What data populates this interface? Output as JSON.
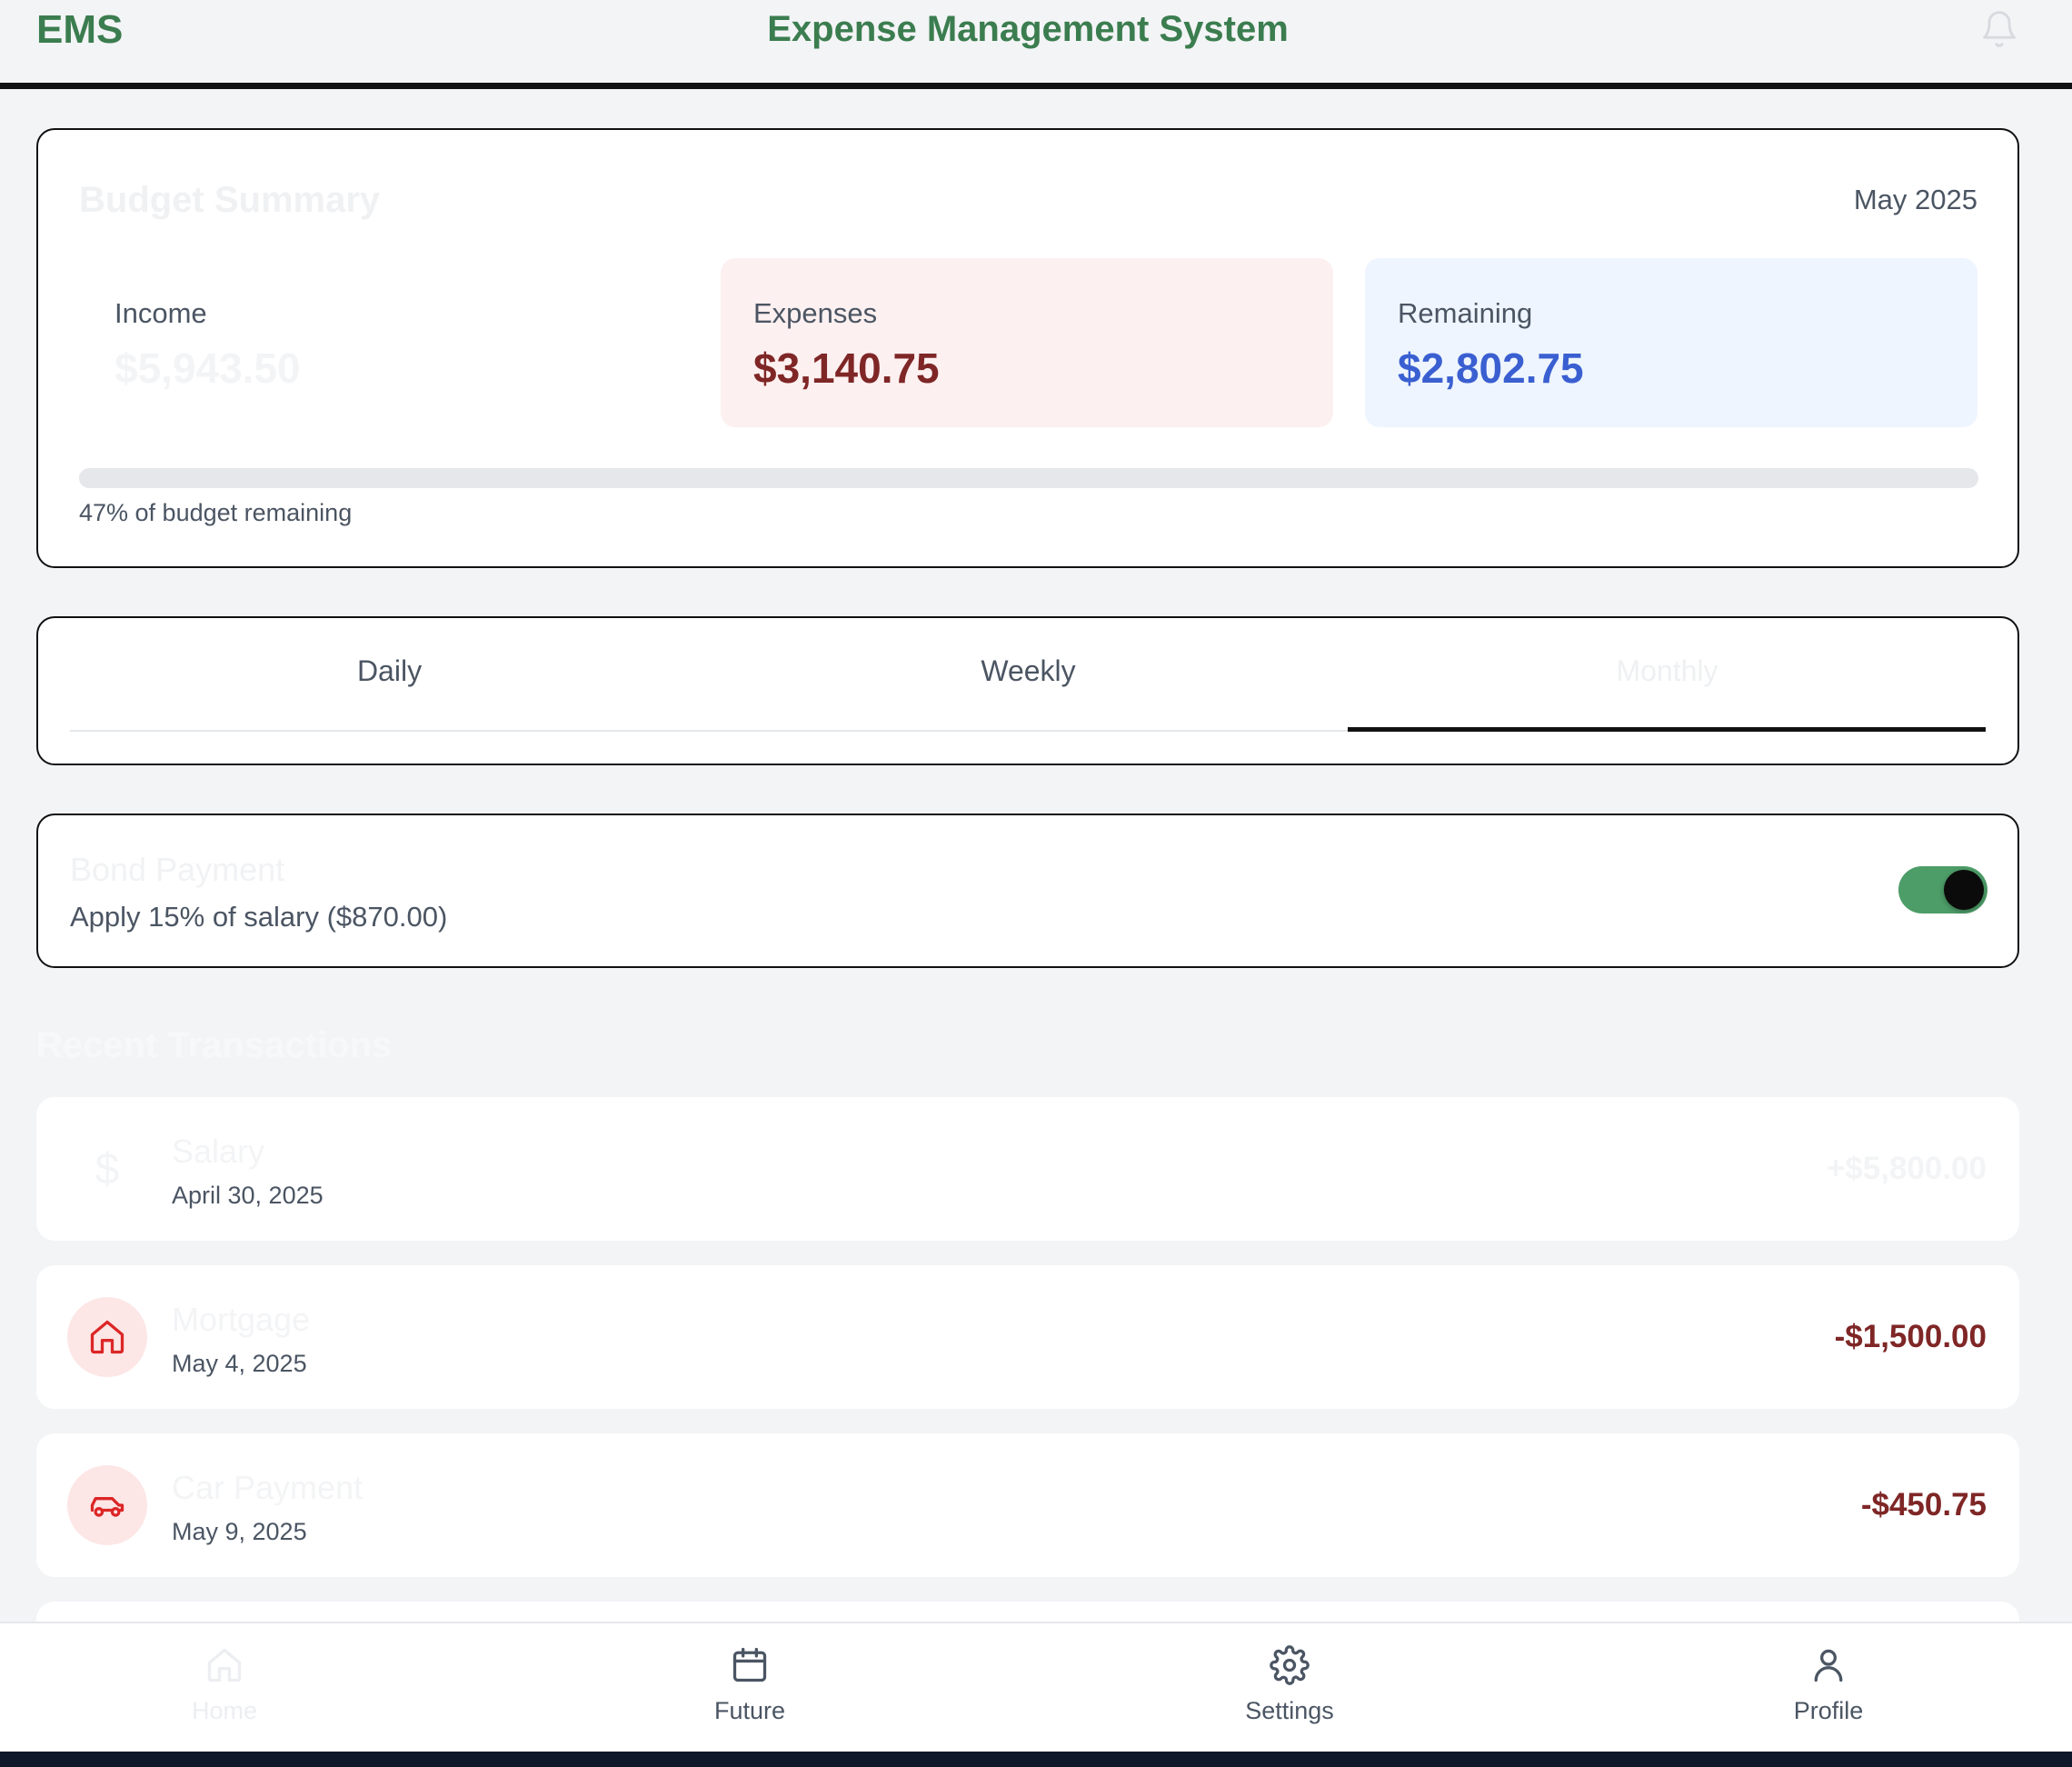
{
  "header": {
    "brand": "EMS",
    "title": "Expense Management System",
    "notification_icon": "bell-icon"
  },
  "summary": {
    "title": "Budget Summary",
    "month": "May 2025",
    "income": {
      "label": "Income",
      "value": "$5,943.50"
    },
    "expenses": {
      "label": "Expenses",
      "value": "$3,140.75"
    },
    "remaining": {
      "label": "Remaining",
      "value": "$2,802.75"
    },
    "progress_text": "47% of budget remaining",
    "remaining_fraction": 0.47
  },
  "tabs": {
    "items": [
      {
        "label": "Daily"
      },
      {
        "label": "Weekly"
      },
      {
        "label": "Monthly"
      }
    ],
    "active": "Monthly"
  },
  "bond": {
    "title": "Bond Payment",
    "description": "Apply 15% of salary ($870.00)",
    "enabled": true
  },
  "recent": {
    "title": "Recent Transactions",
    "transactions": [
      {
        "name": "Salary",
        "date": "April 30, 2025",
        "amount": "+$5,800.00",
        "icon": "dollar-icon",
        "glyph": "$"
      },
      {
        "name": "Mortgage",
        "date": "May 4, 2025",
        "amount": "-$1,500.00",
        "icon": "home-icon"
      },
      {
        "name": "Car Payment",
        "date": "May 9, 2025",
        "amount": "-$450.75",
        "icon": "car-icon"
      }
    ]
  },
  "nav": {
    "items": [
      {
        "label": "Home",
        "icon": "home-icon"
      },
      {
        "label": "Future",
        "icon": "calendar-icon"
      },
      {
        "label": "Settings",
        "icon": "gear-icon"
      },
      {
        "label": "Profile",
        "icon": "user-icon"
      }
    ]
  },
  "colors": {
    "brand_green": "#3b7d4f",
    "expense_red": "#7f2626",
    "remaining_blue": "#3a5fd1",
    "toggle_green": "#4d9d68"
  }
}
